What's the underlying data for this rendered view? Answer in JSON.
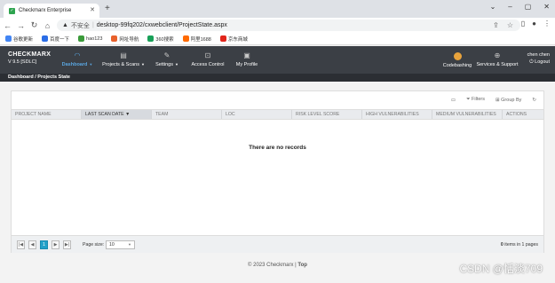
{
  "browser": {
    "tab_title": "Checkmarx Enterprise",
    "tab_favicon": "checkmarx-icon",
    "insecure_label": "不安全",
    "url": "desktop-99fq202/cxwebclient/ProjectState.aspx",
    "bookmarks": [
      {
        "label": "谷歌更新",
        "color": "#4285f4"
      },
      {
        "label": "百度一下",
        "color": "#2b6de6"
      },
      {
        "label": "hao123",
        "color": "#3a9a3a"
      },
      {
        "label": "网址导航",
        "color": "#e8612c"
      },
      {
        "label": "360搜索",
        "color": "#18a058"
      },
      {
        "label": "阿里1688",
        "color": "#ff6a00"
      },
      {
        "label": "京东商城",
        "color": "#e1251b"
      }
    ]
  },
  "app": {
    "logo_name": "CHECKMARX",
    "version": "V 9.5 [SDLC]",
    "nav": [
      {
        "label": "Dashboard",
        "icon": "gauge-icon",
        "active": true,
        "caret": true
      },
      {
        "label": "Projects & Scans",
        "icon": "clipboard-icon",
        "active": false,
        "caret": true
      },
      {
        "label": "Settings",
        "icon": "wrench-icon",
        "active": false,
        "caret": true
      },
      {
        "label": "Access Control",
        "icon": "lock-icon",
        "active": false,
        "caret": false
      },
      {
        "label": "My Profile",
        "icon": "photo-icon",
        "active": false,
        "caret": false
      }
    ],
    "codebashing_label": "Codebashing",
    "support_label": "Services & Support",
    "user_name": "chen chen",
    "logout_label": "Logout",
    "accent": "#5aa6e0"
  },
  "breadcrumb": "Dashboard / Projects State",
  "grid": {
    "filters_label": "Filters",
    "groupby_label": "Group By",
    "columns": [
      "PROJECT NAME",
      "LAST SCAN DATE",
      "TEAM",
      "LOC",
      "RISK LEVEL SCORE",
      "HIGH VULNERABILITIES",
      "MEDIUM VULNERABILITIES",
      "ACTIONS"
    ],
    "sorted_column": "LAST SCAN DATE",
    "empty_message": "There are no records",
    "current_page": "1",
    "page_size_label": "Page size:",
    "page_size": "10",
    "items_info_count": "0",
    "items_info_text": " items in 1 pages"
  },
  "footer": {
    "copyright": "© 2023 Checkmarx |",
    "top_link": "Top"
  },
  "watermark": "CSDN @恬淡709"
}
